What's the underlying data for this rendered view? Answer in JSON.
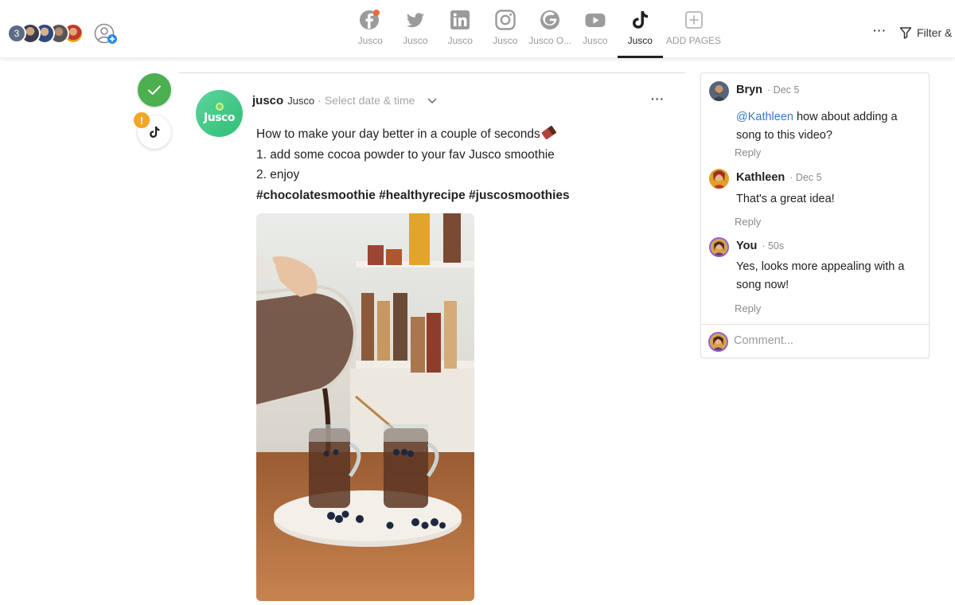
{
  "team": {
    "member_count": "3"
  },
  "tabs": [
    {
      "label": "Jusco",
      "icon": "facebook-icon",
      "active": false
    },
    {
      "label": "Jusco",
      "icon": "twitter-icon",
      "active": false
    },
    {
      "label": "Jusco",
      "icon": "linkedin-icon",
      "active": false
    },
    {
      "label": "Jusco",
      "icon": "instagram-icon",
      "active": false
    },
    {
      "label": "Jusco O...",
      "icon": "google-icon",
      "active": false
    },
    {
      "label": "Jusco",
      "icon": "youtube-icon",
      "active": false
    },
    {
      "label": "Jusco",
      "icon": "tiktok-icon",
      "active": true
    },
    {
      "label": "ADD PAGES",
      "icon": "plus-square-icon",
      "active": false
    }
  ],
  "toolbar": {
    "more_label": "···",
    "filter_label": "Filter &"
  },
  "status": {
    "approved": true,
    "warning_label": "!"
  },
  "post": {
    "page_logo_text": "Jusco",
    "handle": "jusco",
    "page_name": "Jusco",
    "separator": "·",
    "date_placeholder": "Select date & time",
    "menu_label": "···",
    "lines": [
      "How to make your day better in a couple of seconds",
      "1. add some cocoa powder to your fav Jusco smoothie",
      "2. enjoy"
    ],
    "hashtags": "#chocolatesmoothie #healthyrecipe #juscosmoothies"
  },
  "comments": [
    {
      "author": "Bryn",
      "time": "· Dec 5",
      "mention": "@Kathleen",
      "text": " how about adding a song to this video?",
      "reply_label": "Reply"
    },
    {
      "author": "Kathleen",
      "time": "· Dec 5",
      "mention": "",
      "text": "That's a great idea!",
      "reply_label": "Reply"
    },
    {
      "author": "You",
      "time": "· 50s",
      "mention": "",
      "text": "Yes, looks more appealing with a song now!",
      "reply_label": "Reply"
    }
  ],
  "comment_input": {
    "placeholder": "Comment..."
  },
  "colors": {
    "approve": "#4caf50",
    "warning": "#f5a623",
    "mention": "#3b78c9",
    "brand_green": "#2fbf78"
  }
}
